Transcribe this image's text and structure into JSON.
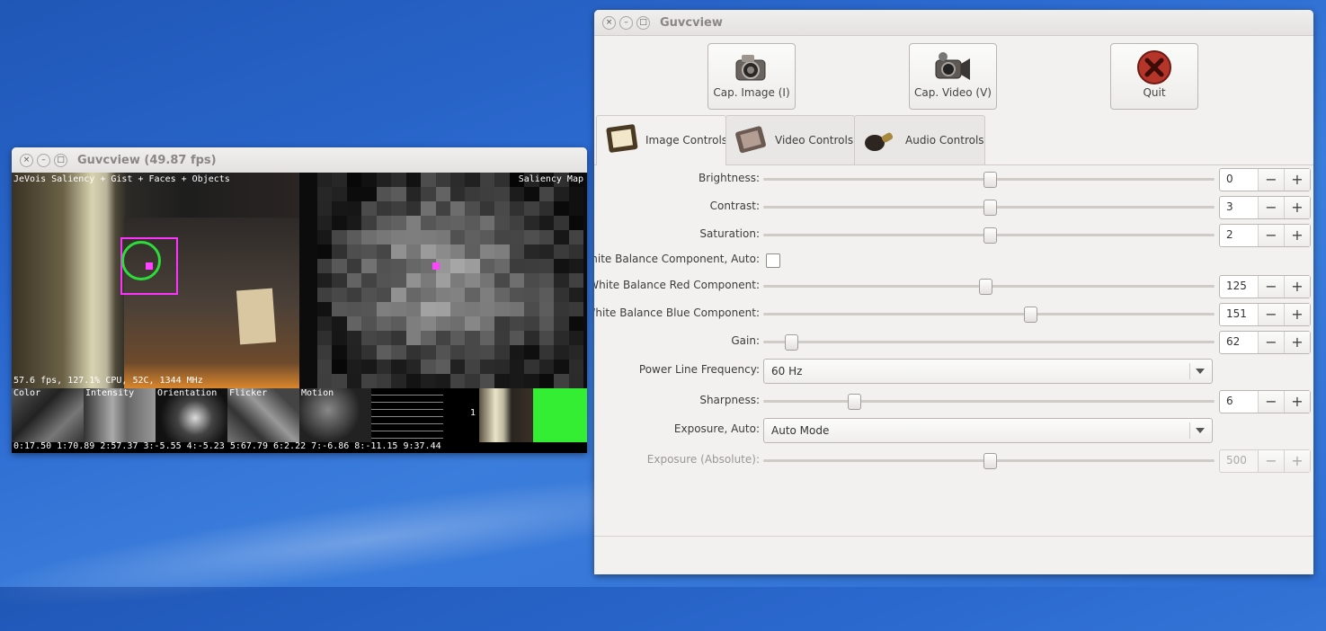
{
  "left_window": {
    "title": "Guvcview  (49.87 fps)",
    "overlay_top_left": "JeVois Saliency + Gist + Faces + Objects",
    "overlay_top_right": "Saliency Map",
    "overlay_status": "57.6 fps, 127.1% CPU, 52C, 1344 MHz",
    "thumb_labels": [
      "Color",
      "Intensity",
      "Orientation",
      "Flicker",
      "Motion"
    ],
    "side_number": "1",
    "gist_values": "0:17.50 1:70.89 2:57.37 3:-5.55 4:-5.23 5:67.79 6:2.22 7:-6.86 8:-11.15 9:37.44"
  },
  "right_window": {
    "title": "Guvcview",
    "buttons": {
      "cap_image": "Cap. Image (I)",
      "cap_video": "Cap. Video (V)",
      "quit": "Quit"
    },
    "tabs": [
      "Image Controls",
      "Video Controls",
      "Audio Controls"
    ],
    "controls": {
      "brightness": {
        "label": "Brightness:",
        "value": "0",
        "level": 0.5
      },
      "contrast": {
        "label": "Contrast:",
        "value": "3",
        "level": 0.5
      },
      "saturation": {
        "label": "Saturation:",
        "value": "2",
        "level": 0.5
      },
      "wb_auto": {
        "label": "White Balance Component, Auto:",
        "checked": false
      },
      "wb_red": {
        "label": "White Balance Red Component:",
        "value": "125",
        "level": 0.49
      },
      "wb_blue": {
        "label": "White Balance Blue Component:",
        "value": "151",
        "level": 0.59
      },
      "gain": {
        "label": "Gain:",
        "value": "62",
        "level": 0.06
      },
      "power_line": {
        "label": "Power Line Frequency:",
        "value": "60 Hz"
      },
      "sharpness": {
        "label": "Sharpness:",
        "value": "6",
        "level": 0.2
      },
      "exposure_auto": {
        "label": "Exposure, Auto:",
        "value": "Auto Mode"
      },
      "exposure_abs": {
        "label": "Exposure (Absolute):",
        "value": "500",
        "level": 0.5
      }
    }
  },
  "symbols": {
    "minus": "−",
    "plus": "+",
    "close": "×",
    "minimize": "–",
    "maximize": "□"
  }
}
